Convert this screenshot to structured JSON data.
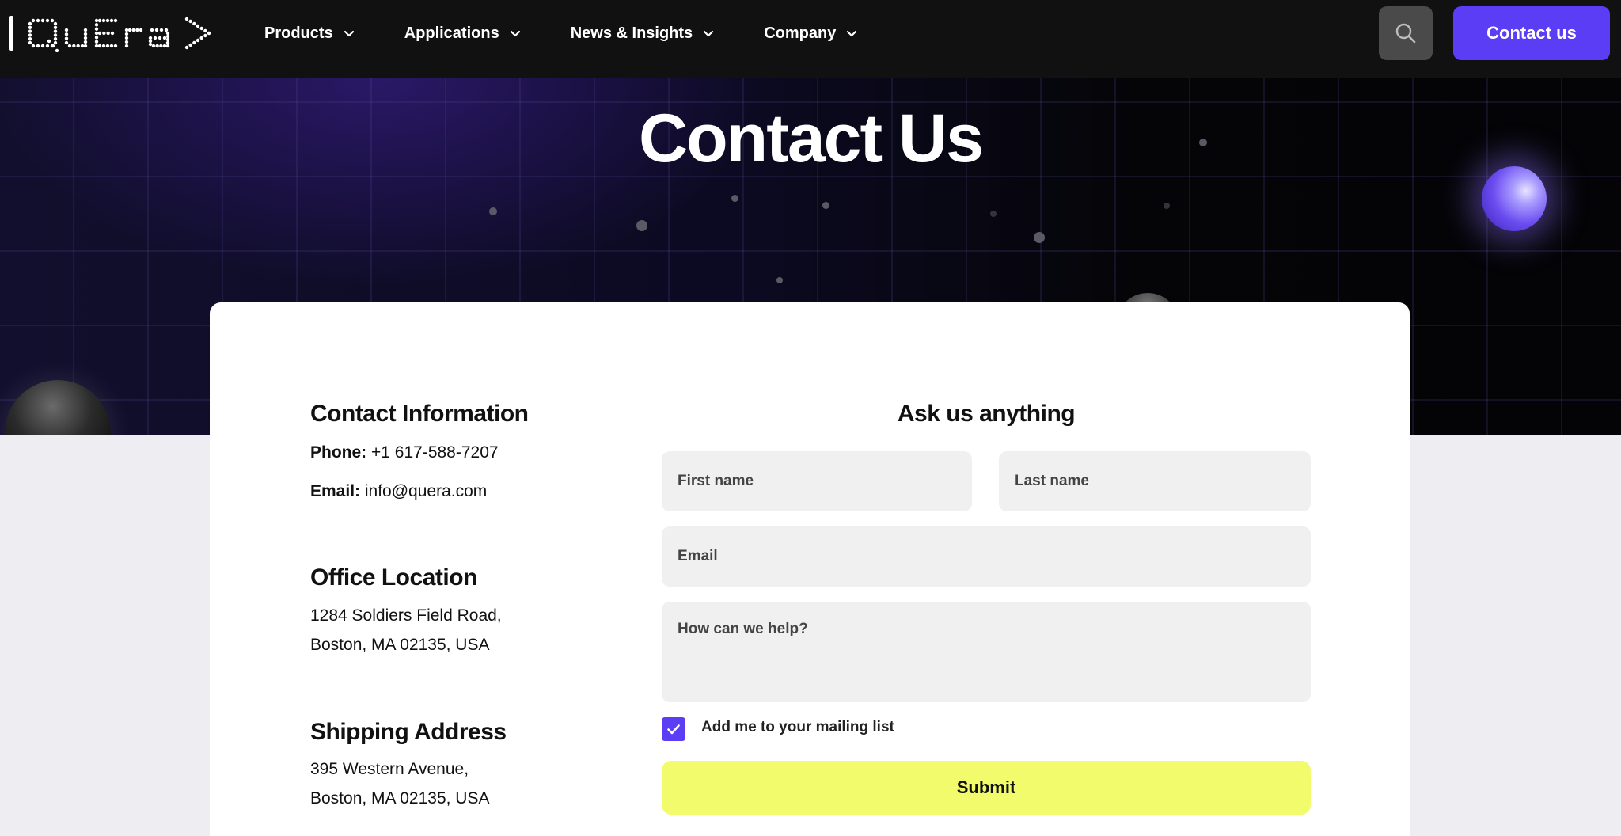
{
  "nav": {
    "logo_text": "|QuEra>",
    "items": [
      {
        "label": "Products"
      },
      {
        "label": "Applications"
      },
      {
        "label": "News & Insights"
      },
      {
        "label": "Company"
      }
    ],
    "contact_label": "Contact us"
  },
  "hero": {
    "title": "Contact Us"
  },
  "contact_info": {
    "heading": "Contact Information",
    "phone_label": "Phone:",
    "phone": "+1 617-588-7207",
    "email_label": "Email:",
    "email": "info@quera.com"
  },
  "office": {
    "heading": "Office Location",
    "line1": "1284 Soldiers Field Road,",
    "line2": "Boston, MA 02135, USA"
  },
  "shipping": {
    "heading": "Shipping Address",
    "line1": "395 Western Avenue,",
    "line2": "Boston, MA 02135, USA"
  },
  "form": {
    "title": "Ask us anything",
    "first_name_placeholder": "First name",
    "last_name_placeholder": "Last name",
    "email_placeholder": "Email",
    "message_placeholder": "How can we help?",
    "mailing_list_label": "Add me to your mailing list",
    "mailing_list_checked": true,
    "submit_label": "Submit"
  },
  "colors": {
    "accent": "#5b3df5",
    "submit": "#f2fb6b",
    "nav_bg": "#111111"
  }
}
